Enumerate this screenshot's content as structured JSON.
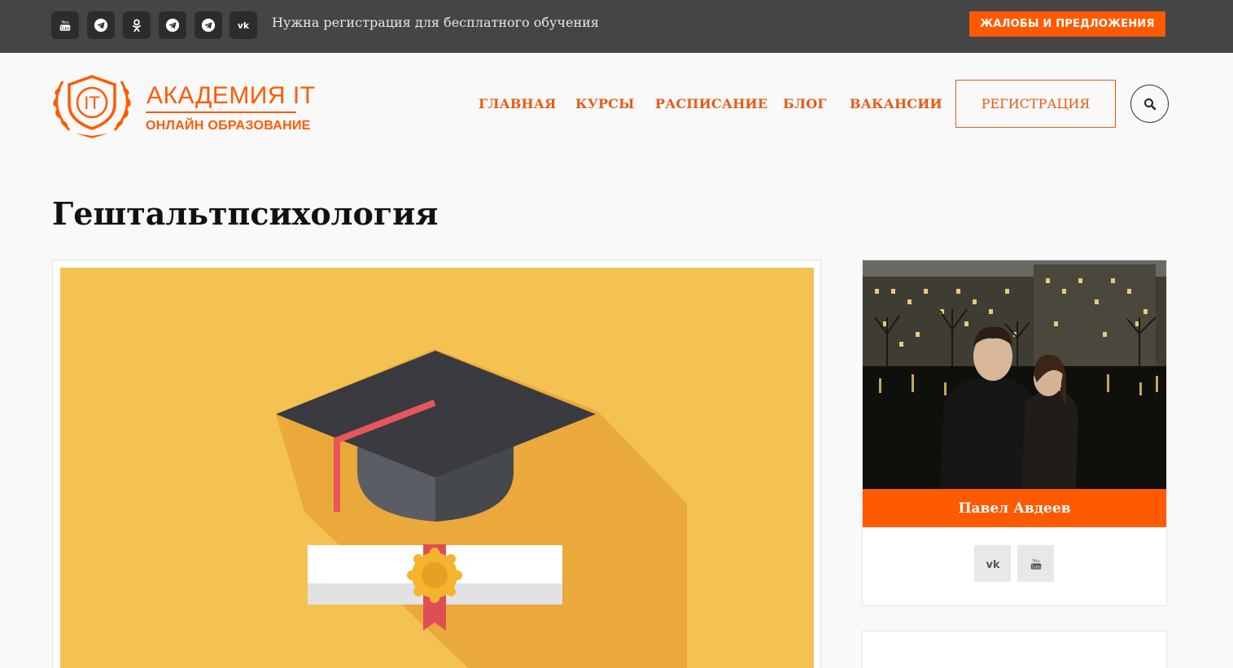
{
  "topbar": {
    "social_icons": [
      "youtube-icon",
      "telegram-icon",
      "odnoklassniki-icon",
      "telegram-icon",
      "telegram-icon",
      "vk-icon"
    ],
    "text": "Нужна регистрация для бесплатного обучения",
    "complaints_label": "ЖАЛОБЫ И ПРЕДЛОЖЕНИЯ"
  },
  "logo": {
    "title": "АКАДЕМИЯ IT",
    "subtitle": "ОНЛАЙН ОБРАЗОВАНИЕ",
    "emblem_text": "IT"
  },
  "nav": {
    "items": [
      "ГЛАВНАЯ",
      "КУРСЫ",
      "РАСПИСАНИЕ",
      "БЛОГ",
      "ВАКАНСИИ"
    ],
    "register_label": "РЕГИСТРАЦИЯ"
  },
  "page": {
    "title": "Гештальтпсихология"
  },
  "author": {
    "name": "Павел Авдеев",
    "social_icons": [
      "vk-icon",
      "youtube-icon"
    ]
  },
  "colors": {
    "accent": "#ff5a00",
    "topbar": "#454545",
    "hero_bg": "#f4c253"
  }
}
